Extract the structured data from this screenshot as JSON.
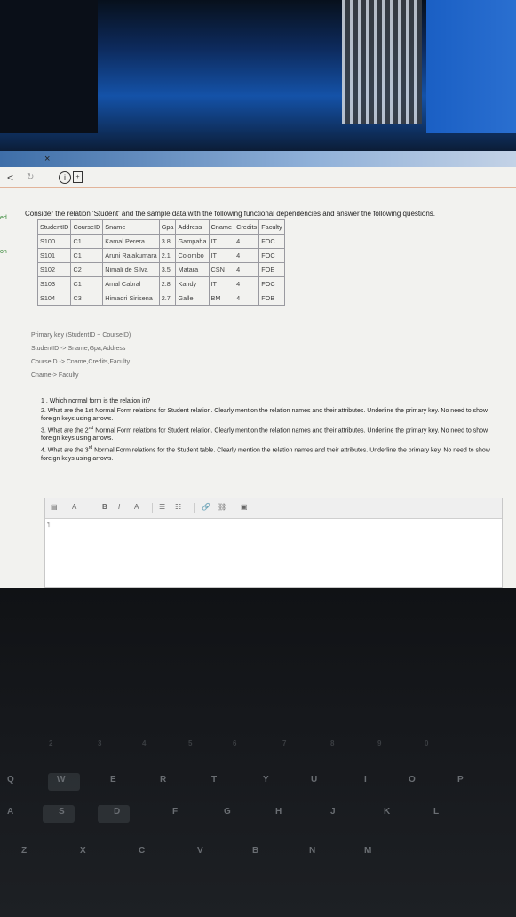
{
  "browser": {
    "close_label": "×",
    "back_label": "<",
    "info_label": "i"
  },
  "sidebar": {
    "label_1": "ed",
    "label_2": "on"
  },
  "question": {
    "prompt": "Consider the relation 'Student' and the sample data with the following functional dependencies and answer the following questions.",
    "table": {
      "headers": [
        "StudentID",
        "CourseID",
        "Sname",
        "Gpa",
        "Address",
        "Cname",
        "Credits",
        "Faculty"
      ],
      "rows": [
        [
          "S100",
          "C1",
          "Kamal Perera",
          "3.8",
          "Gampaha",
          "IT",
          "4",
          "FOC"
        ],
        [
          "S101",
          "C1",
          "Aruni Rajakumara",
          "2.1",
          "Colombo",
          "IT",
          "4",
          "FOC"
        ],
        [
          "S102",
          "C2",
          "Nimali de Silva",
          "3.5",
          "Matara",
          "CSN",
          "4",
          "FOE"
        ],
        [
          "S103",
          "C1",
          "Amal Cabral",
          "2.8",
          "Kandy",
          "IT",
          "4",
          "FOC"
        ],
        [
          "S104",
          "C3",
          "Himadri Sirisena",
          "2.7",
          "Galle",
          "BM",
          "4",
          "FOB"
        ]
      ]
    },
    "dependencies": [
      "Primary key (StudentID + CourseID)",
      "StudentID -> Sname,Gpa,Address",
      "CourseID -> Cname,Credits,Faculty",
      "Cname-> Faculty"
    ],
    "items": [
      "1 . Which normal form is the relation in?",
      "2. What are the 1st Normal Form relations for Student relation. Clearly mention the relation names and their attributes. Underline the primary key. No need to show foreign keys using arrows.",
      "3. What are the 2",
      "nd",
      " Normal Form relations for Student relation. Clearly mention the relation names and their attributes. Underline the primary key. No need to show foreign keys using arrows.",
      "4. What are the 3",
      "rd",
      " Normal Form relations for the Student table. Clearly mention the relation names and their attributes. Underline the primary key. No need to show foreign keys using arrows."
    ]
  },
  "editor": {
    "toolbar": {
      "font_size": "A",
      "bold": "B",
      "italic": "I",
      "color": "A",
      "bullets": "☰",
      "numbers": "☷",
      "link": "🔗",
      "unlink": "⛓",
      "image": "▣"
    },
    "body": "¶"
  },
  "keyboard": {
    "row_num": [
      "2",
      "3",
      "4",
      "5",
      "6",
      "7",
      "8",
      "9",
      "0"
    ],
    "row_q": [
      "Q",
      "W",
      "E",
      "R",
      "T",
      "Y",
      "U",
      "I",
      "O",
      "P"
    ],
    "row_a": [
      "A",
      "S",
      "D",
      "F",
      "G",
      "H",
      "J",
      "K",
      "L"
    ],
    "row_z": [
      "Z",
      "X",
      "C",
      "V",
      "B",
      "N",
      "M"
    ]
  }
}
